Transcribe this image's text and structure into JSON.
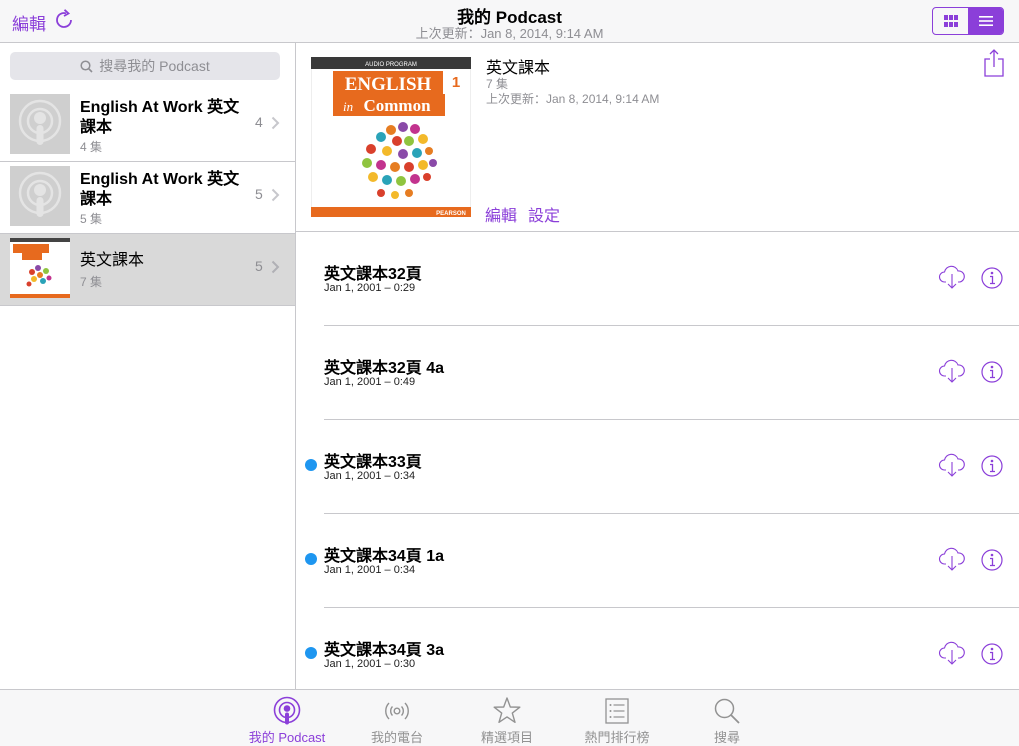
{
  "colors": {
    "accent": "#8b3fd9",
    "unplayed_dot": "#1e96f0",
    "secondary_text": "#8e8e93"
  },
  "navbar": {
    "edit_label": "編輯",
    "title": "我的 Podcast",
    "subtitle": "上次更新：Jan 8, 2014, 9:14 AM",
    "view_toggle": [
      "grid-icon",
      "list-icon"
    ]
  },
  "sidebar": {
    "search_placeholder": "搜尋我的 Podcast",
    "items": [
      {
        "title": "English At Work 英文課本",
        "count": "4 集",
        "num": "4",
        "artwork": "podcast-placeholder-icon"
      },
      {
        "title": "English At Work 英文課本",
        "count": "5 集",
        "num": "5",
        "artwork": "podcast-placeholder-icon"
      },
      {
        "title": "英文課本",
        "count": "7 集",
        "num": "5",
        "artwork": "english-in-common-cover",
        "selected": true
      }
    ]
  },
  "detail": {
    "title": "英文課本",
    "count": "7 集",
    "updated": "上次更新：Jan 8, 2014, 9:14 AM",
    "edit_label": "編輯",
    "settings_label": "設定",
    "cover": {
      "program": "AUDIO PROGRAM",
      "word1": "ENGLISH",
      "word2": "in",
      "word3": "Common",
      "level": "1",
      "publisher": "PEARSON"
    }
  },
  "episodes": [
    {
      "title": "英文課本32頁",
      "meta": "Jan 1, 2001 – 0:29",
      "unplayed": false
    },
    {
      "title": "英文課本32頁 4a",
      "meta": "Jan 1, 2001 – 0:49",
      "unplayed": false
    },
    {
      "title": "英文課本33頁",
      "meta": "Jan 1, 2001 – 0:34",
      "unplayed": true
    },
    {
      "title": "英文課本34頁 1a",
      "meta": "Jan 1, 2001 – 0:34",
      "unplayed": true
    },
    {
      "title": "英文課本34頁 3a",
      "meta": "Jan 1, 2001 – 0:30",
      "unplayed": true
    }
  ],
  "tabbar": {
    "tabs": [
      {
        "label": "我的 Podcast",
        "icon": "podcast-icon",
        "active": true
      },
      {
        "label": "我的電台",
        "icon": "station-icon",
        "active": false
      },
      {
        "label": "精選項目",
        "icon": "star-icon",
        "active": false
      },
      {
        "label": "熱門排行榜",
        "icon": "top-charts-icon",
        "active": false
      },
      {
        "label": "搜尋",
        "icon": "search-icon",
        "active": false
      }
    ]
  }
}
